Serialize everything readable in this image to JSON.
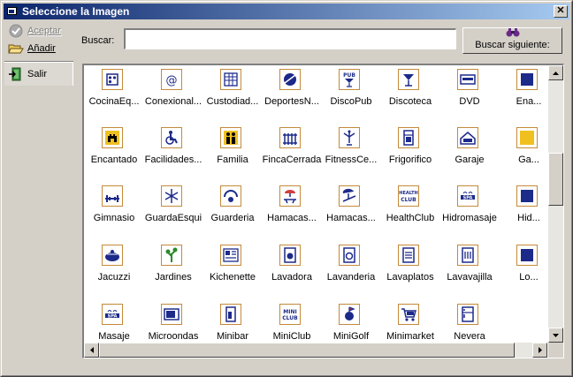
{
  "window": {
    "title": "Seleccione la Imagen",
    "close_label": "✕"
  },
  "sidebar": {
    "accept_label": "Aceptar",
    "add_label": "Añadir",
    "exit_label": "Salir"
  },
  "search": {
    "label": "Buscar:",
    "value": "",
    "find_next_label": "Buscar siguiente:"
  },
  "icons": [
    [
      "CocinaEq...",
      "Conexional...",
      "Custodiad...",
      "DeportesN...",
      "DiscoPub",
      "Discoteca",
      "DVD",
      "Ena..."
    ],
    [
      "Encantado",
      "Facilidades...",
      "Familia",
      "FincaCerrada",
      "FitnessCe...",
      "Frigorifico",
      "Garaje",
      "Ga..."
    ],
    [
      "Gimnasio",
      "GuardaEsqui",
      "Guarderia",
      "Hamacas...",
      "Hamacas...",
      "HealthClub",
      "Hidromasaje",
      "Hid..."
    ],
    [
      "Jacuzzi",
      "Jardines",
      "Kichenette",
      "Lavadora",
      "Lavanderia",
      "Lavaplatos",
      "Lavavajilla",
      "Lo..."
    ],
    [
      "Masaje",
      "Microondas",
      "Minibar",
      "MiniClub",
      "MiniGolf",
      "Minimarket",
      "Nevera",
      ""
    ]
  ],
  "icon_texts": {
    "pub": "PUB",
    "health": "HEALTH",
    "club": "CLUB",
    "mini": "MINI",
    "spa": "SPA"
  },
  "colors": {
    "icon_fill": "#1c2a8a",
    "icon_border": "#c48a3a",
    "title_start": "#0a246a",
    "title_end": "#a6caf0"
  }
}
